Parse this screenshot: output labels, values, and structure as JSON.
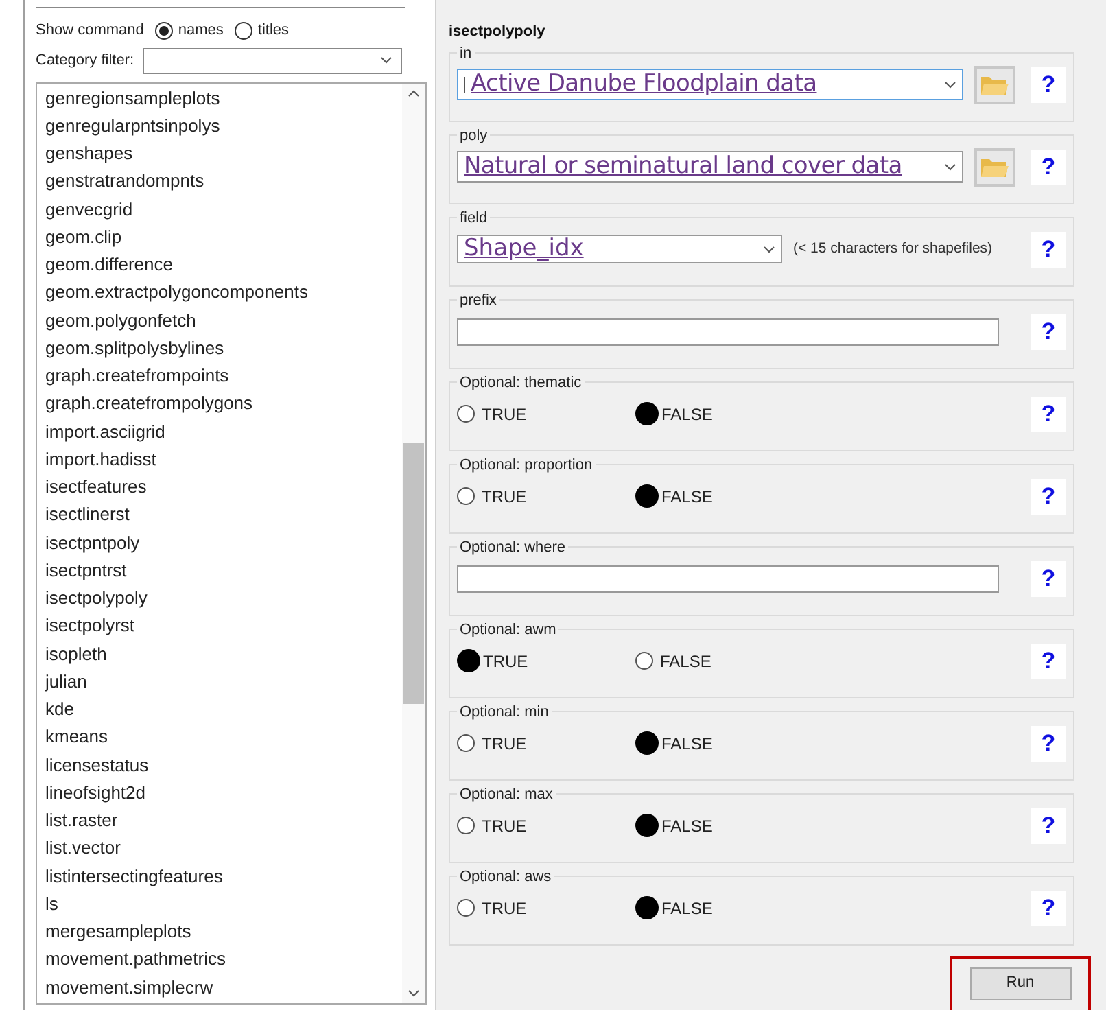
{
  "show_command": {
    "label": "Show command",
    "options": [
      {
        "label": "names",
        "selected": true
      },
      {
        "label": "titles",
        "selected": false
      }
    ]
  },
  "category_filter": {
    "label": "Category filter:"
  },
  "commands": [
    "genregionsampleplots",
    "genregularpntsinpolys",
    "genshapes",
    "genstratrandompnts",
    "genvecgrid",
    "geom.clip",
    "geom.difference",
    "geom.extractpolygoncomponents",
    "geom.polygonfetch",
    "geom.splitpolysbylines",
    "graph.createfrompoints",
    "graph.createfrompolygons",
    "import.asciigrid",
    "import.hadisst",
    "isectfeatures",
    "isectlinerst",
    "isectpntpoly",
    "isectpntrst",
    "isectpolypoly",
    "isectpolyrst",
    "isopleth",
    "julian",
    "kde",
    "kmeans",
    "licensestatus",
    "lineofsight2d",
    "list.raster",
    "list.vector",
    "listintersectingfeatures",
    "ls",
    "mergesampleplots",
    "movement.pathmetrics",
    "movement.simplecrw"
  ],
  "form": {
    "title": "isectpolypoly",
    "params": [
      {
        "kind": "layer",
        "label": "in",
        "value": "Active Danube Floodplain data",
        "focused": true
      },
      {
        "kind": "layer",
        "label": "poly",
        "value": "Natural or seminatural land cover data",
        "focused": false
      },
      {
        "kind": "field",
        "label": "field",
        "value": "Shape_idx",
        "note": "(< 15 characters for shapefiles)"
      },
      {
        "kind": "text",
        "label": "prefix"
      },
      {
        "kind": "bool",
        "label": "Optional: thematic",
        "options": [
          {
            "label": "TRUE",
            "selected": false
          },
          {
            "label": "FALSE",
            "selected": true
          }
        ]
      },
      {
        "kind": "bool",
        "label": "Optional: proportion",
        "options": [
          {
            "label": "TRUE",
            "selected": false
          },
          {
            "label": "FALSE",
            "selected": true
          }
        ]
      },
      {
        "kind": "text",
        "label": "Optional: where"
      },
      {
        "kind": "bool",
        "label": "Optional: awm",
        "options": [
          {
            "label": "TRUE",
            "selected": true
          },
          {
            "label": "FALSE",
            "selected": false
          }
        ]
      },
      {
        "kind": "bool",
        "label": "Optional: min",
        "options": [
          {
            "label": "TRUE",
            "selected": false
          },
          {
            "label": "FALSE",
            "selected": true
          }
        ]
      },
      {
        "kind": "bool",
        "label": "Optional: max",
        "options": [
          {
            "label": "TRUE",
            "selected": false
          },
          {
            "label": "FALSE",
            "selected": true
          }
        ]
      },
      {
        "kind": "bool",
        "label": "Optional: aws",
        "options": [
          {
            "label": "TRUE",
            "selected": false
          },
          {
            "label": "FALSE",
            "selected": true
          }
        ]
      }
    ],
    "help": "?",
    "run": "Run"
  }
}
